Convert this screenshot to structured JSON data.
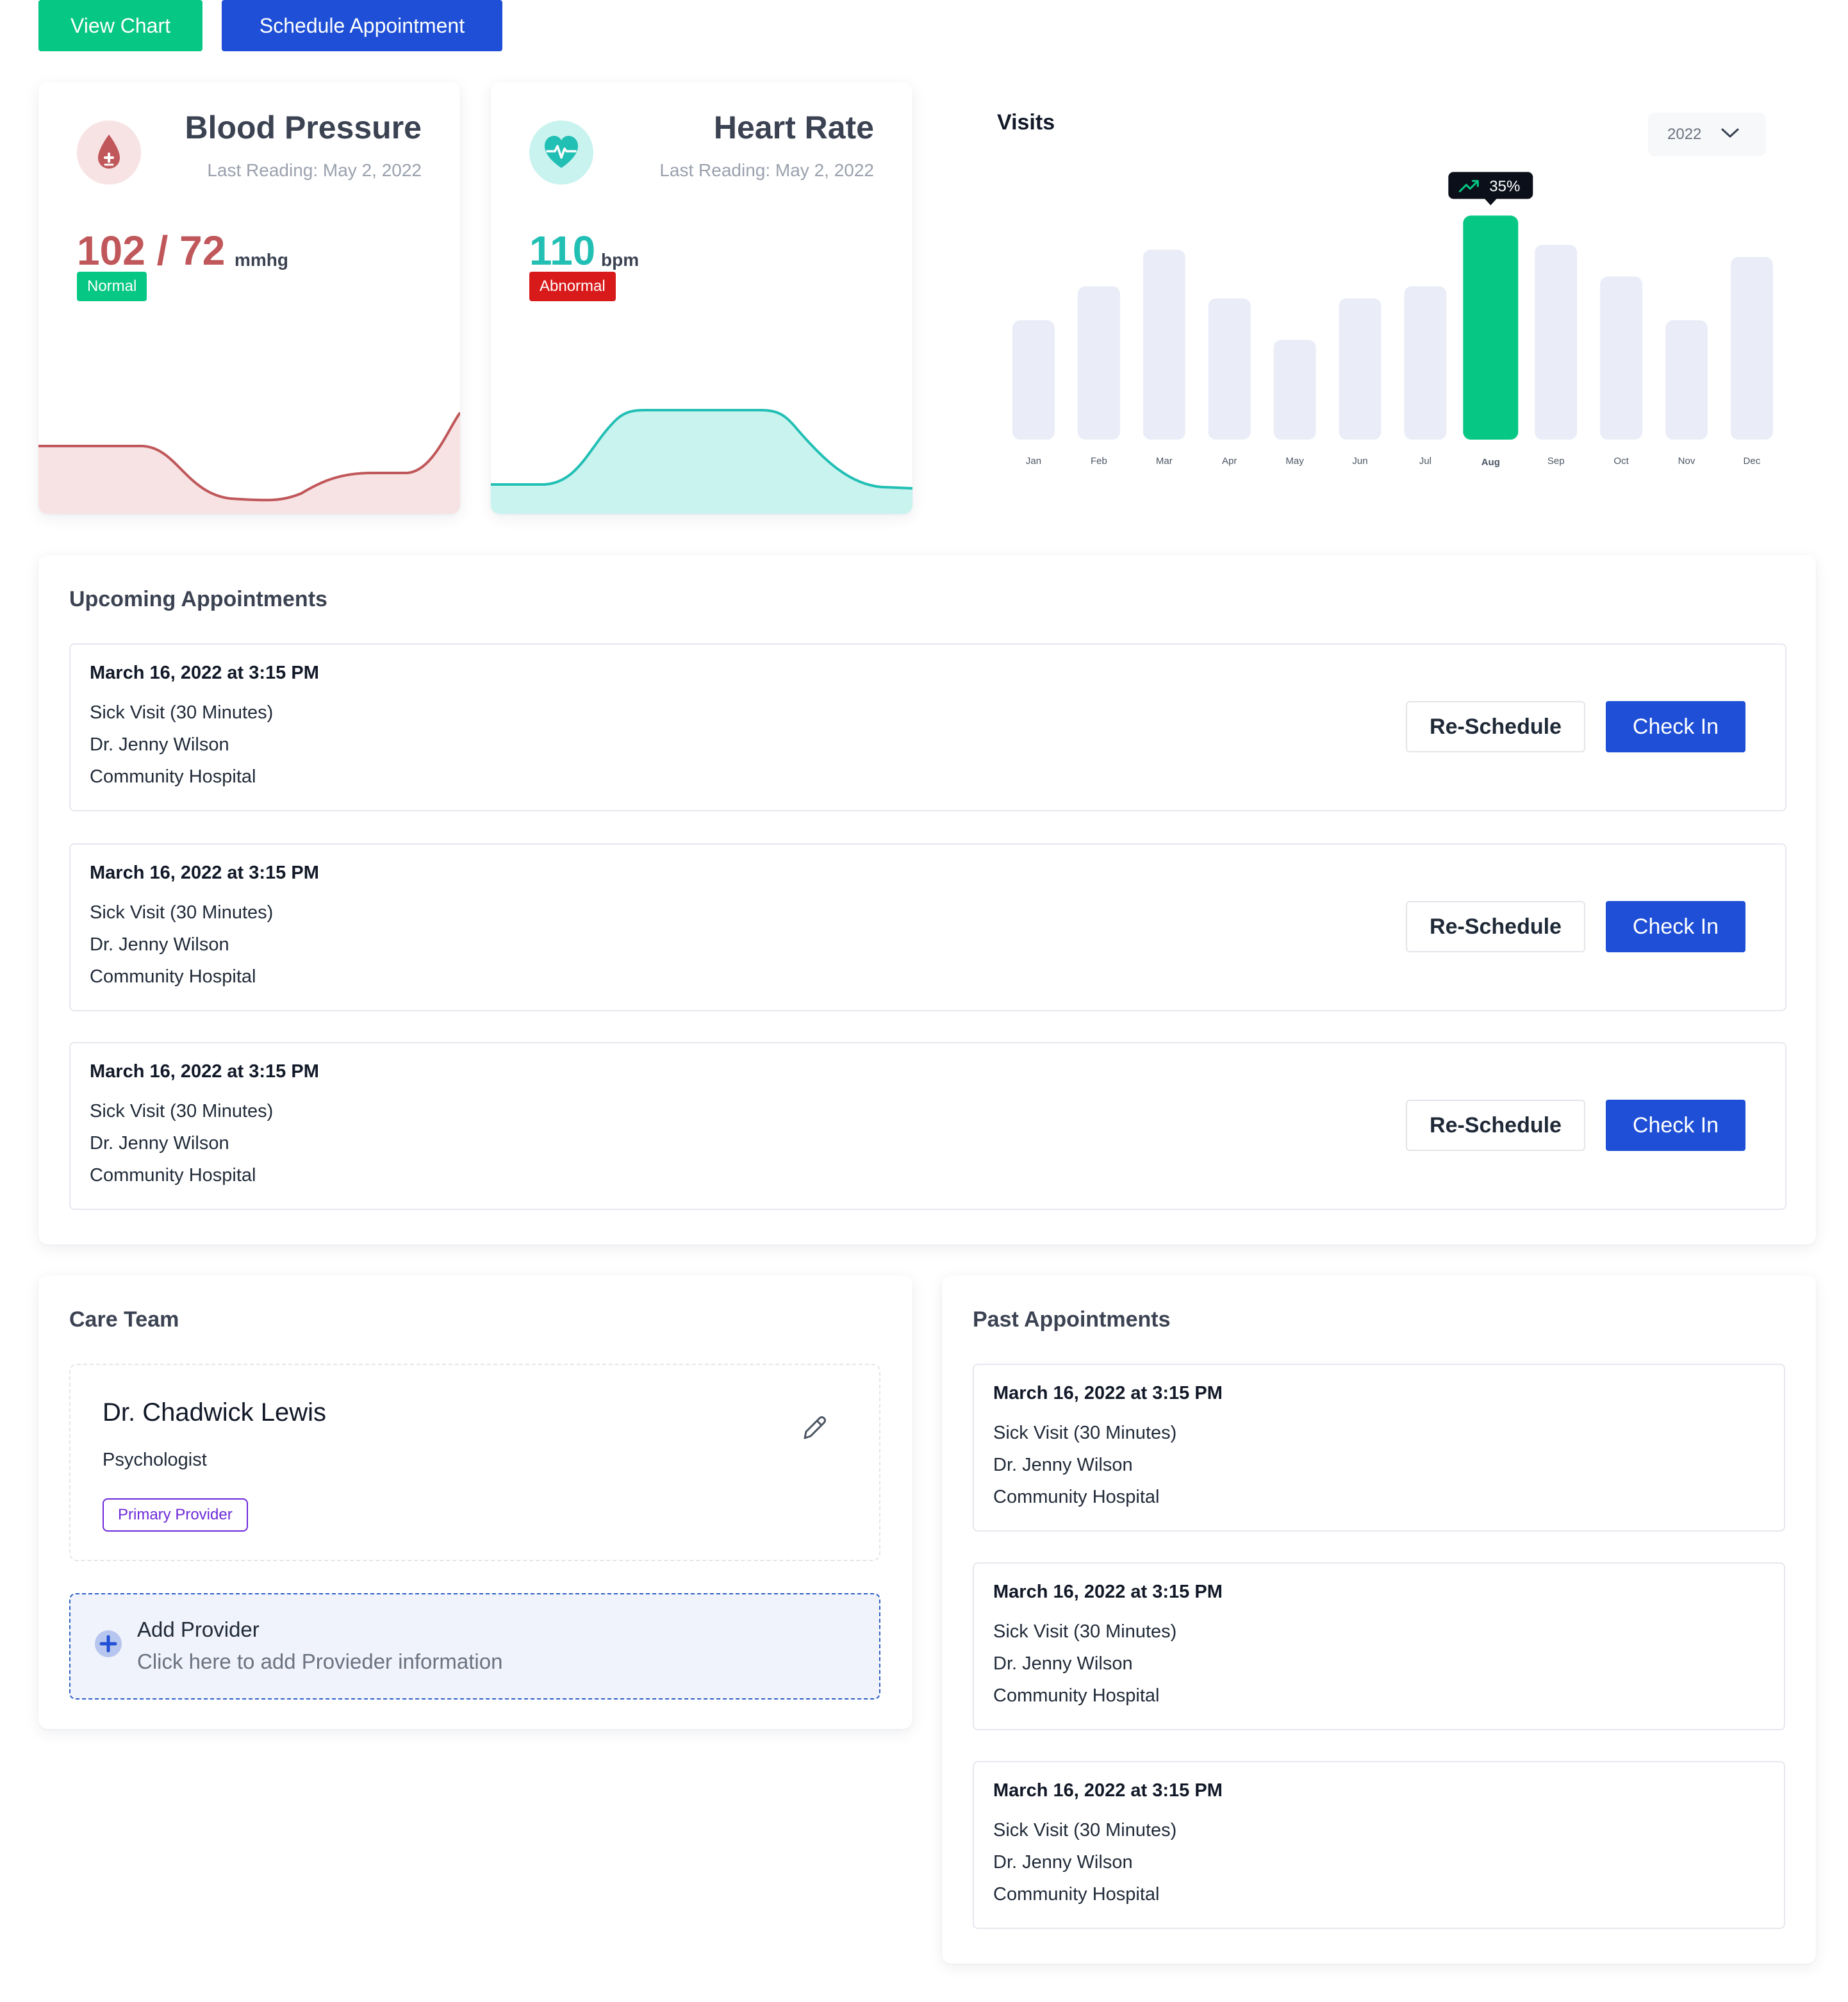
{
  "actions": {
    "view_chart": "View Chart",
    "schedule": "Schedule Appointment"
  },
  "colors": {
    "green": "#06c783",
    "blue": "#1e4fd6",
    "bp_red": "#c0575a",
    "hr_teal": "#22bfb4",
    "abnormal": "#d91a1a"
  },
  "blood_pressure": {
    "title": "Blood Pressure",
    "last_reading": "Last Reading: May 2, 2022",
    "value": "102 / 72",
    "unit": "mmhg",
    "status": "Normal",
    "icon": "blood-drop-icon"
  },
  "heart_rate": {
    "title": "Heart Rate",
    "last_reading": "Last Reading: May 2, 2022",
    "value": "110",
    "unit": "bpm",
    "status": "Abnormal",
    "icon": "heart-pulse-icon"
  },
  "visits": {
    "title": "Visits",
    "year": "2022",
    "highlight_label": "35%",
    "highlight_month": "Aug"
  },
  "chart_data": {
    "type": "bar",
    "categories": [
      "Jan",
      "Feb",
      "Mar",
      "Apr",
      "May",
      "Jun",
      "Jul",
      "Aug",
      "Sep",
      "Oct",
      "Nov",
      "Dec"
    ],
    "values": [
      49,
      63,
      78,
      58,
      41,
      58,
      63,
      92,
      80,
      67,
      49,
      75
    ],
    "highlight_index": 7,
    "highlight_annotation": "35%",
    "title": "Visits",
    "xlabel": "",
    "ylabel": "",
    "ylim": [
      0,
      100
    ],
    "grid": false
  },
  "upcoming": {
    "title": "Upcoming Appointments",
    "reschedule_label": "Re-Schedule",
    "checkin_label": "Check In",
    "items": [
      {
        "date": "March 16, 2022 at 3:15 PM",
        "type": "Sick Visit (30 Minutes)",
        "doctor": "Dr. Jenny Wilson",
        "location": "Community Hospital"
      },
      {
        "date": "March 16, 2022 at 3:15 PM",
        "type": "Sick Visit (30 Minutes)",
        "doctor": "Dr. Jenny Wilson",
        "location": "Community Hospital"
      },
      {
        "date": "March 16, 2022 at 3:15 PM",
        "type": "Sick Visit (30 Minutes)",
        "doctor": "Dr. Jenny Wilson",
        "location": "Community Hospital"
      }
    ]
  },
  "care_team": {
    "title": "Care Team",
    "provider": {
      "name": "Dr. Chadwick Lewis",
      "role": "Psychologist",
      "badge": "Primary Provider"
    },
    "add": {
      "title": "Add Provider",
      "subtitle": "Click here to add Provieder information"
    }
  },
  "past": {
    "title": "Past Appointments",
    "items": [
      {
        "date": "March 16, 2022 at 3:15 PM",
        "type": "Sick Visit (30 Minutes)",
        "doctor": "Dr. Jenny Wilson",
        "location": "Community Hospital"
      },
      {
        "date": "March 16, 2022 at 3:15 PM",
        "type": "Sick Visit (30 Minutes)",
        "doctor": "Dr. Jenny Wilson",
        "location": "Community Hospital"
      },
      {
        "date": "March 16, 2022 at 3:15 PM",
        "type": "Sick Visit (30 Minutes)",
        "doctor": "Dr. Jenny Wilson",
        "location": "Community Hospital"
      }
    ]
  }
}
